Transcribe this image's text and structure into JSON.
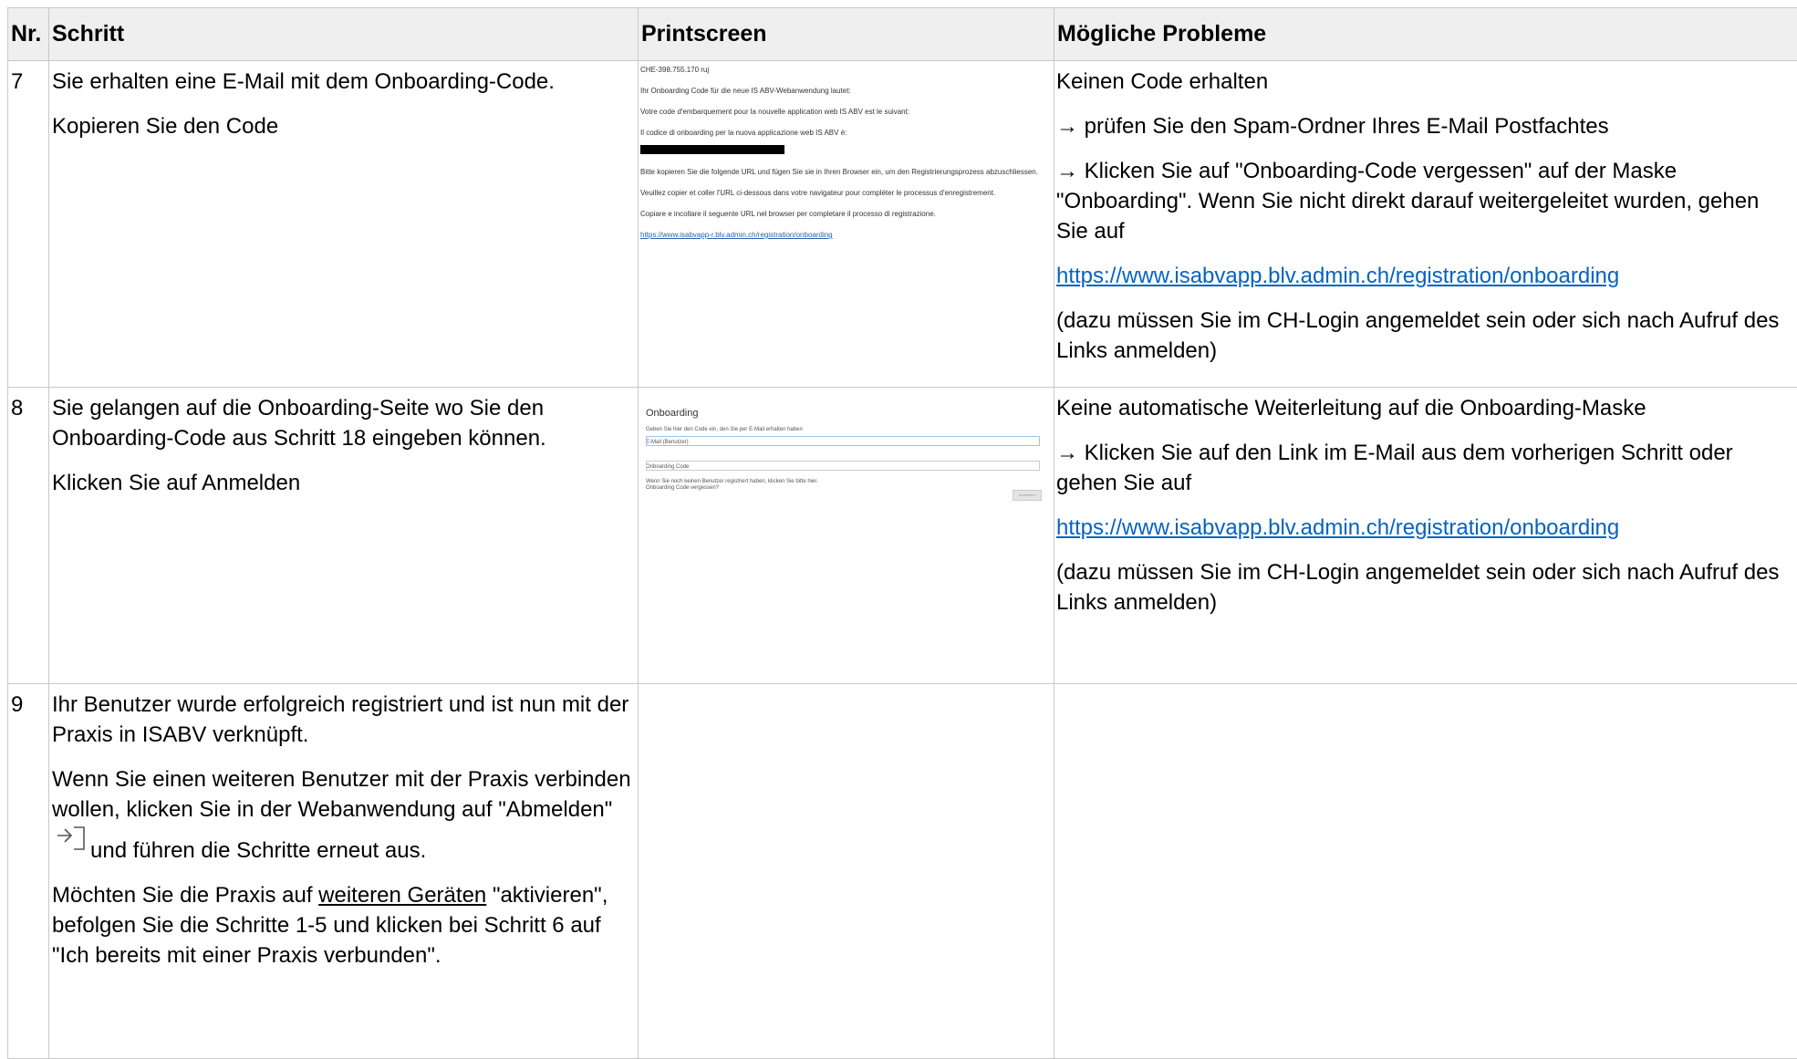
{
  "headers": {
    "nr": "Nr.",
    "schritt": "Schritt",
    "printscreen": "Printscreen",
    "probleme": "Mögliche Probleme"
  },
  "rows": [
    {
      "nr": "7",
      "schritt": [
        "Sie erhalten eine E-Mail mit dem Onboarding-Code.",
        "Kopieren Sie den Code"
      ],
      "screenshot": {
        "lines": [
          "CHE-398.755.170 ruj",
          "Ihr Onboarding Code für die neue IS ABV-Webanwendung lautet:",
          "Votre code d'embarquement pour la nouvelle application web IS ABV est le suivant:",
          "Il codice di onboarding per la nuova applicazione web IS ABV è:"
        ],
        "after_lines": [
          "Bitte kopieren Sie die folgende URL und fügen Sie sie in Ihren Browser ein, um den Registrierungsprozess abzuschliessen.",
          "Veuillez copier et coller l'URL ci-dessous dans votre navigateur pour compléter le processus d'enregistrement.",
          "Copiare e incollare il seguente URL nel browser per completare il processo di registrazione."
        ],
        "link": "https://www.isabvapp-r.blv.admin.ch/registration/onboarding"
      },
      "probleme": {
        "p1": "Keinen Code erhalten",
        "p2": "→ prüfen Sie den Spam-Ordner Ihres E-Mail Postfachtes",
        "p3": "→ Klicken Sie auf \"Onboarding-Code vergessen\" auf der Maske \"Onboarding\". Wenn Sie nicht direkt darauf weitergeleitet wurden, gehen Sie auf",
        "link": "https://www.isabvapp.blv.admin.ch/registration/onboarding",
        "p5": "(dazu müssen Sie im CH-Login angemeldet sein oder sich nach Aufruf des Links anmelden)"
      }
    },
    {
      "nr": "8",
      "schritt": [
        "Sie gelangen auf die Onboarding-Seite wo Sie den Onboarding-Code aus Schritt 18 eingeben können.",
        "Klicken Sie auf Anmelden"
      ],
      "screenshot": {
        "title": "Onboarding",
        "info": "Geben Sie hier den Code ein, den Sie per E-Mail erhalten haben",
        "label_email": "E-Mail (Benutzer)",
        "label_code": "Onboarding Code",
        "hint_line1": "Wenn Sie noch keinen Benutzer registriert haben, klicken Sie bitte hier.",
        "hint_line2": "Onboarding Code vergessen?",
        "button": "Anmelden"
      },
      "probleme": {
        "p1": "Keine automatische Weiterleitung auf die Onboarding-Maske",
        "p2": "→ Klicken Sie auf den Link im E-Mail aus dem vorherigen Schritt oder gehen Sie auf",
        "link": "https://www.isabvapp.blv.admin.ch/registration/onboarding",
        "p4": "(dazu müssen Sie im CH-Login angemeldet sein oder sich nach Aufruf des Links anmelden)"
      }
    },
    {
      "nr": "9",
      "schritt": {
        "p1": "Ihr Benutzer wurde erfolgreich registriert und ist nun mit der Praxis in ISABV verknüpft.",
        "p2_before": "Wenn Sie einen weiteren Benutzer mit der Praxis verbinden wollen, klicken Sie in der Webanwendung auf \"Abmelden\"",
        "p2_after": "und führen die Schritte erneut aus.",
        "p3_before": "Möchten Sie die Praxis auf",
        "p3_link": "weiteren Geräten",
        "p3_after": "\"aktivieren\", befolgen Sie die Schritte 1-5 und klicken bei Schritt 6 auf \"Ich bereits mit einer Praxis verbunden\"."
      },
      "icons": {
        "logout": "logout-icon"
      }
    }
  ]
}
